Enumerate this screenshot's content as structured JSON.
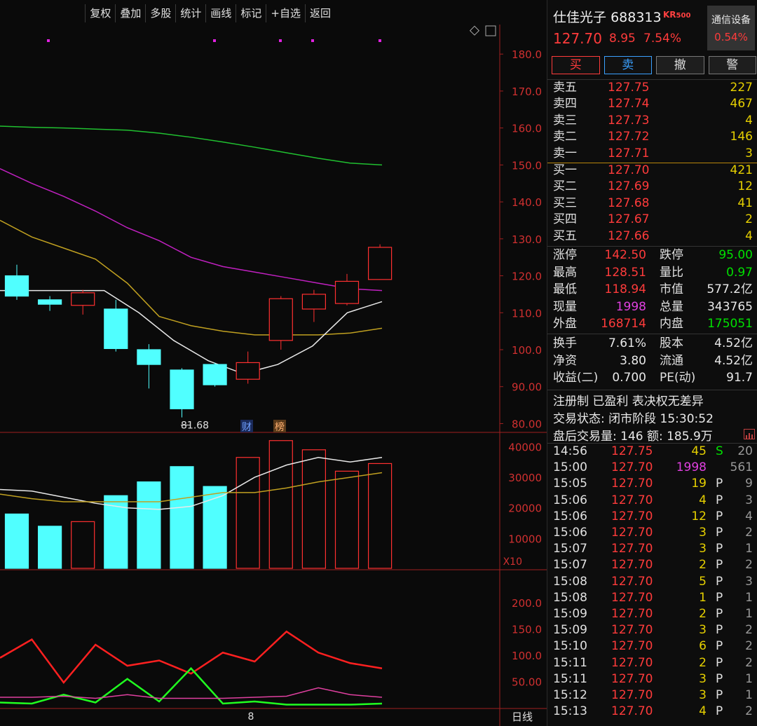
{
  "toolbar": [
    "复权",
    "叠加",
    "多股",
    "统计",
    "画线",
    "标记",
    "+自选",
    "返回"
  ],
  "stock": {
    "name": "仕佳光子",
    "code": "688313",
    "badge": "KR",
    "badge_sub": "500",
    "price": "127.70",
    "change": "8.95",
    "pct": "7.54%"
  },
  "sector": {
    "name": "通信设备",
    "pct": "0.54%"
  },
  "trade_buttons": {
    "buy": "买",
    "sell": "卖",
    "cancel": "撤",
    "alert": "警"
  },
  "asks": [
    {
      "label": "卖五",
      "price": "127.75",
      "vol": "227"
    },
    {
      "label": "卖四",
      "price": "127.74",
      "vol": "467"
    },
    {
      "label": "卖三",
      "price": "127.73",
      "vol": "4"
    },
    {
      "label": "卖二",
      "price": "127.72",
      "vol": "146"
    },
    {
      "label": "卖一",
      "price": "127.71",
      "vol": "3"
    }
  ],
  "bids": [
    {
      "label": "买一",
      "price": "127.70",
      "vol": "421"
    },
    {
      "label": "买二",
      "price": "127.69",
      "vol": "12"
    },
    {
      "label": "买三",
      "price": "127.68",
      "vol": "41"
    },
    {
      "label": "买四",
      "price": "127.67",
      "vol": "2"
    },
    {
      "label": "买五",
      "price": "127.66",
      "vol": "4"
    }
  ],
  "stats1": [
    {
      "k1": "涨停",
      "v1": "142.50",
      "c1": "red",
      "k2": "跌停",
      "v2": "95.00",
      "c2": "green"
    },
    {
      "k1": "最高",
      "v1": "128.51",
      "c1": "red",
      "k2": "量比",
      "v2": "0.97",
      "c2": "green"
    },
    {
      "k1": "最低",
      "v1": "118.94",
      "c1": "red",
      "k2": "市值",
      "v2": "577.2亿",
      "c2": "white"
    },
    {
      "k1": "现量",
      "v1": "1998",
      "c1": "magenta",
      "k2": "总量",
      "v2": "343765",
      "c2": "white"
    },
    {
      "k1": "外盘",
      "v1": "168714",
      "c1": "red",
      "k2": "内盘",
      "v2": "175051",
      "c2": "green"
    }
  ],
  "stats2": [
    {
      "k1": "换手",
      "v1": "7.61%",
      "k2": "股本",
      "v2": "4.52亿"
    },
    {
      "k1": "净资",
      "v1": "3.80",
      "k2": "流通",
      "v2": "4.52亿"
    },
    {
      "k1": "收益(二)",
      "v1": "0.700",
      "k2": "PE(动)",
      "v2": "91.7"
    }
  ],
  "info": {
    "tags": "注册制 已盈利 表决权无差异",
    "status": "交易状态: 闭市阶段 15:30:52",
    "after_hours": "盘后交易量: 146  额: 185.9万"
  },
  "ticks": [
    {
      "time": "14:56",
      "price": "127.75",
      "vol": "45",
      "flag": "S",
      "n": "20"
    },
    {
      "time": "15:00",
      "price": "127.70",
      "vol": "1998",
      "flag": "",
      "n": "561"
    },
    {
      "time": "15:05",
      "price": "127.70",
      "vol": "19",
      "flag": "P",
      "n": "9"
    },
    {
      "time": "15:06",
      "price": "127.70",
      "vol": "4",
      "flag": "P",
      "n": "3"
    },
    {
      "time": "15:06",
      "price": "127.70",
      "vol": "12",
      "flag": "P",
      "n": "4"
    },
    {
      "time": "15:06",
      "price": "127.70",
      "vol": "3",
      "flag": "P",
      "n": "2"
    },
    {
      "time": "15:07",
      "price": "127.70",
      "vol": "3",
      "flag": "P",
      "n": "1"
    },
    {
      "time": "15:07",
      "price": "127.70",
      "vol": "2",
      "flag": "P",
      "n": "2"
    },
    {
      "time": "15:08",
      "price": "127.70",
      "vol": "5",
      "flag": "P",
      "n": "3"
    },
    {
      "time": "15:08",
      "price": "127.70",
      "vol": "1",
      "flag": "P",
      "n": "1"
    },
    {
      "time": "15:09",
      "price": "127.70",
      "vol": "2",
      "flag": "P",
      "n": "1"
    },
    {
      "time": "15:09",
      "price": "127.70",
      "vol": "3",
      "flag": "P",
      "n": "2"
    },
    {
      "time": "15:10",
      "price": "127.70",
      "vol": "6",
      "flag": "P",
      "n": "2"
    },
    {
      "time": "15:11",
      "price": "127.70",
      "vol": "2",
      "flag": "P",
      "n": "2"
    },
    {
      "time": "15:11",
      "price": "127.70",
      "vol": "3",
      "flag": "P",
      "n": "1"
    },
    {
      "time": "15:12",
      "price": "127.70",
      "vol": "3",
      "flag": "P",
      "n": "1"
    },
    {
      "time": "15:13",
      "price": "127.70",
      "vol": "4",
      "flag": "P",
      "n": "2"
    }
  ],
  "chart_data": {
    "type": "candlestick",
    "price_axis": {
      "ticks": [
        "180.0",
        "170.0",
        "160.0",
        "150.0",
        "140.0",
        "130.0",
        "120.0",
        "110.0",
        "100.0",
        "90.00",
        "80.00"
      ],
      "ylim": [
        78,
        188
      ]
    },
    "candles": [
      {
        "open": 120,
        "close": 114.5,
        "high": 123,
        "low": 113.5,
        "color": "cyan"
      },
      {
        "open": 113.5,
        "close": 112.3,
        "high": 114.5,
        "low": 110.5,
        "color": "cyan"
      },
      {
        "open": 112,
        "close": 115.4,
        "high": 116.2,
        "low": 109.5,
        "color": "red"
      },
      {
        "open": 111,
        "close": 100.3,
        "high": 113.5,
        "low": 99.5,
        "color": "cyan"
      },
      {
        "open": 100,
        "close": 96,
        "high": 101.5,
        "low": 89.5,
        "color": "cyan"
      },
      {
        "open": 94.5,
        "close": 84,
        "high": 95,
        "low": 81.68,
        "color": "cyan"
      },
      {
        "open": 96,
        "close": 90.5,
        "high": 96.5,
        "low": 90,
        "color": "cyan"
      },
      {
        "open": 92,
        "close": 96.5,
        "high": 99.5,
        "low": 90.8,
        "color": "red"
      },
      {
        "open": 102.5,
        "close": 113.8,
        "high": 114.5,
        "low": 100,
        "color": "red"
      },
      {
        "open": 111,
        "close": 115,
        "high": 116.2,
        "low": 107.5,
        "color": "red"
      },
      {
        "open": 112.5,
        "close": 118.5,
        "high": 120.5,
        "low": 112,
        "color": "red"
      },
      {
        "open": 119,
        "close": 127.7,
        "high": 128.51,
        "low": 118.94,
        "color": "red"
      }
    ],
    "ma_lines": [
      {
        "color": "#20c030",
        "values": [
          160.5,
          160.2,
          160,
          159.7,
          159.4,
          158.6,
          157.5,
          156.2,
          154.8,
          153.3,
          151.8,
          150.5,
          150
        ]
      },
      {
        "color": "#c020c0",
        "values": [
          149,
          145,
          141.5,
          137.5,
          133,
          129.5,
          125,
          122.5,
          121,
          119.5,
          118,
          116.5,
          116
        ]
      },
      {
        "color": "#c0a020",
        "values": [
          135,
          130.5,
          127.5,
          124.5,
          118,
          109,
          106.5,
          105,
          104,
          104,
          104,
          104.5,
          105.8
        ]
      },
      {
        "color": "#e8e8e8",
        "values": [
          116,
          116,
          116,
          116,
          110,
          102.5,
          97,
          93.5,
          96,
          101,
          110,
          113
        ]
      }
    ],
    "low_annotation": "81.68",
    "markers": [
      "财",
      "榜"
    ],
    "volume_axis": {
      "ticks": [
        "40000",
        "30000",
        "20000",
        "10000"
      ],
      "unit": "X10",
      "ylim": [
        0,
        44000
      ]
    },
    "volumes": [
      {
        "v": 18000,
        "color": "cyan"
      },
      {
        "v": 14000,
        "color": "cyan"
      },
      {
        "v": 15500,
        "color": "red"
      },
      {
        "v": 24000,
        "color": "cyan"
      },
      {
        "v": 28500,
        "color": "cyan"
      },
      {
        "v": 33500,
        "color": "cyan"
      },
      {
        "v": 27000,
        "color": "cyan"
      },
      {
        "v": 36500,
        "color": "red"
      },
      {
        "v": 42000,
        "color": "red"
      },
      {
        "v": 39000,
        "color": "red"
      },
      {
        "v": 32000,
        "color": "red"
      },
      {
        "v": 34500,
        "color": "red"
      }
    ],
    "vol_ma": [
      {
        "color": "#e8e8e8",
        "values": [
          26000,
          25500,
          23500,
          21500,
          20000,
          19500,
          20500,
          24000,
          30000,
          34000,
          36500,
          35000,
          36500
        ]
      },
      {
        "color": "#c0a020",
        "values": [
          24500,
          23000,
          22000,
          22000,
          22000,
          22000,
          23500,
          25000,
          25000,
          26500,
          28500,
          30000,
          31500
        ]
      }
    ],
    "indicator_axis": {
      "ticks": [
        "200.0",
        "150.0",
        "100.0",
        "50.00"
      ],
      "ylim": [
        0,
        260
      ]
    },
    "indicator_lines": [
      {
        "color": "#ff2020",
        "values": [
          95,
          130,
          48,
          120,
          80,
          90,
          65,
          105,
          88,
          145,
          105,
          85,
          75
        ]
      },
      {
        "color": "#20ff20",
        "values": [
          10,
          8,
          25,
          10,
          55,
          12,
          75,
          8,
          12,
          6,
          6,
          6,
          8
        ]
      },
      {
        "color": "#e040a0",
        "values": [
          20,
          20,
          22,
          18,
          25,
          18,
          18,
          18,
          20,
          22,
          38,
          25,
          20
        ]
      }
    ],
    "x_label": "8",
    "period": "日线"
  }
}
